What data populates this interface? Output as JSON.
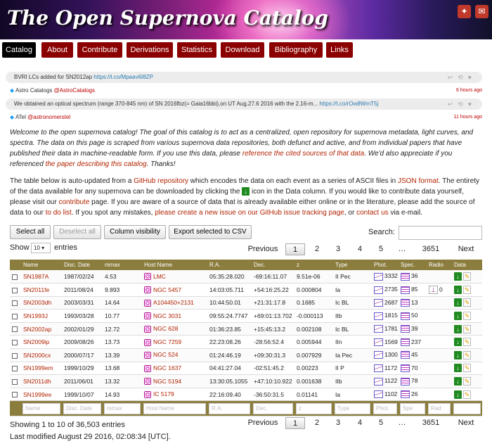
{
  "header": {
    "title": "The Open Supernova Catalog"
  },
  "nav": {
    "tabs": [
      "Catalog",
      "About",
      "Contribute",
      "Derivations",
      "Statistics",
      "Download",
      "Bibliography",
      "Links"
    ]
  },
  "tweets": [
    {
      "text": "BVRI LCs added for SN2012ap",
      "link": "https://t.co/Mpaav6I8ZP",
      "author": "Astro Catalogs",
      "handle": "@AstroCatalogs",
      "ago": "6 hours ago"
    },
    {
      "text": "We obtained an optical spectrum (range 370-845 nm) of SN 2016fbz(= Gaia16bbi),on UT Aug.27.6 2016 with the 2.16-m...",
      "link": "https://t.co/rOw8WrnT5j",
      "author": "ATel",
      "handle": "@astronomerstel",
      "ago": "11 hours ago"
    }
  ],
  "intro": {
    "p1a": "Welcome to the open supernova catalog! The goal of this catalog is to act as a centralized, open repository for supernova metadata, light curves, and spectra. The data on this page is scraped from various supernova data repositories, both defunct and active, and from individual papers that have published their data in machine-readable form. If you use this data, please ",
    "p1link1": "reference the cited sources of that data",
    "p1b": ". We'd also appreciate if you referenced ",
    "p1link2": "the paper describing this catalog",
    "p1c": ". Thanks!",
    "p2a": "The table below is auto-updated from a ",
    "p2link1": "GitHub repository",
    "p2b": " which encodes the data on each event as a series of ASCII files in ",
    "p2link2": "JSON format",
    "p2c": ". The entirety of the data available for any supernova can be downloaded by clicking the ",
    "p2d": " icon in the Data column. If you would like to contribute data yourself, please visit our ",
    "p2link3": "contribute",
    "p2e": " page. If you are aware of a source of data that is already available either online or in the literature, please add the source of data to our ",
    "p2link4": "to do list",
    "p2f": ". If you spot any mistakes, ",
    "p2link5": "please create a new issue on our GitHub issue tracking page",
    "p2g": ", or ",
    "p2link6": "contact us",
    "p2h": " via e-mail."
  },
  "controls": {
    "select_all": "Select all",
    "deselect_all": "Deselect all",
    "column_visibility": "Column visibility",
    "export": "Export selected to CSV",
    "search_label": "Search:",
    "show_label": "Show",
    "show_value": "10",
    "entries_label": "entries"
  },
  "pagination": {
    "previous": "Previous",
    "pages": [
      "1",
      "2",
      "3",
      "4",
      "5",
      "…",
      "3651"
    ],
    "next": "Next"
  },
  "table": {
    "columns": [
      "Name",
      "Disc. Date",
      "mmax",
      "Host Name",
      "R.A.",
      "Dec.",
      "z",
      "Type",
      "Phot.",
      "Spec.",
      "Radio",
      "Data"
    ],
    "rows": [
      {
        "name": "SN1987A",
        "date": "1987/02/24",
        "mmax": "4.53",
        "host": "LMC",
        "ra": "05:35:28.020",
        "dec": "-69:16:11.07",
        "z": "9.51e-06",
        "type": "II Pec",
        "phot": "3332",
        "spec": "36",
        "radio": ""
      },
      {
        "name": "SN2011fe",
        "date": "2011/08/24",
        "mmax": "9.893",
        "host": "NGC 5457",
        "ra": "14:03:05.711",
        "dec": "+54:16:25.22",
        "z": "0.000804",
        "type": "Ia",
        "phot": "2735",
        "spec": "85",
        "radio": "0"
      },
      {
        "name": "SN2003dh",
        "date": "2003/03/31",
        "mmax": "14.64",
        "host": "A104450+2131",
        "ra": "10:44:50.01",
        "dec": "+21:31:17.8",
        "z": "0.1685",
        "type": "Ic BL",
        "phot": "2687",
        "spec": "13",
        "radio": ""
      },
      {
        "name": "SN1993J",
        "date": "1993/03/28",
        "mmax": "10.77",
        "host": "NGC 3031",
        "ra": "09:55:24.7747",
        "dec": "+69:01:13.702",
        "z": "-0.000113",
        "type": "IIb",
        "phot": "1815",
        "spec": "50",
        "radio": ""
      },
      {
        "name": "SN2002ap",
        "date": "2002/01/29",
        "mmax": "12.72",
        "host": "NGC 628",
        "ra": "01:36:23.85",
        "dec": "+15:45:13.2",
        "z": "0.002108",
        "type": "Ic BL",
        "phot": "1781",
        "spec": "39",
        "radio": ""
      },
      {
        "name": "SN2009ip",
        "date": "2009/08/26",
        "mmax": "13.73",
        "host": "NGC 7259",
        "ra": "22:23:08.26",
        "dec": "-28:56:52.4",
        "z": "0.005944",
        "type": "IIn",
        "phot": "1569",
        "spec": "237",
        "radio": ""
      },
      {
        "name": "SN2000cx",
        "date": "2000/07/17",
        "mmax": "13.39",
        "host": "NGC 524",
        "ra": "01:24:46.19",
        "dec": "+09:30:31.3",
        "z": "0.007929",
        "type": "Ia Pec",
        "phot": "1300",
        "spec": "45",
        "radio": ""
      },
      {
        "name": "SN1999em",
        "date": "1999/10/29",
        "mmax": "13.68",
        "host": "NGC 1637",
        "ra": "04:41:27.04",
        "dec": "-02:51:45.2",
        "z": "0.00223",
        "type": "II P",
        "phot": "1172",
        "spec": "70",
        "radio": ""
      },
      {
        "name": "SN2011dh",
        "date": "2011/06/01",
        "mmax": "13.32",
        "host": "NGC 5194",
        "ra": "13:30:05.1055",
        "dec": "+47:10:10.922",
        "z": "0.001638",
        "type": "IIb",
        "phot": "1122",
        "spec": "78",
        "radio": ""
      },
      {
        "name": "SN1999ee",
        "date": "1999/10/07",
        "mmax": "14.93",
        "host": "IC 5179",
        "ra": "22:16:09.40",
        "dec": "-36:50:31.5",
        "z": "0.01141",
        "type": "Ia",
        "phot": "1102",
        "spec": "26",
        "radio": ""
      }
    ],
    "filters": [
      "Name",
      "Disc. Date",
      "mmax",
      "Host Name",
      "R.A.",
      "Dec.",
      "z",
      "Type",
      "Phot.",
      "Spe",
      "Rad",
      ""
    ]
  },
  "footer": {
    "showing": "Showing 1 to 10 of 36,503 entries",
    "modified": "Last modified August 29 2016, 02:08:34 [UTC]."
  }
}
